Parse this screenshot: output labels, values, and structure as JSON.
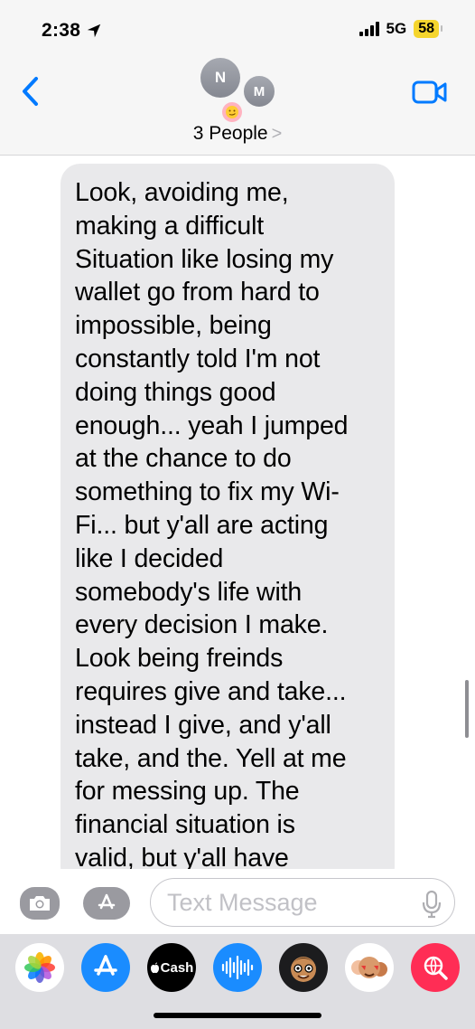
{
  "status_bar": {
    "time": "2:38",
    "network": "5G",
    "battery": "58"
  },
  "header": {
    "avatars": [
      {
        "initial": "N"
      },
      {
        "initial": "M"
      }
    ],
    "group_name": "3 People",
    "chevron": ">"
  },
  "message": {
    "text": "Look, avoiding me,\nmaking a difficult\nSituation like losing my\nwallet go from hard to\nimpossible, being\nconstantly told I'm not\ndoing things good\nenough... yeah I jumped\nat the chance to do\nsomething to fix my Wi-\nFi... but y'all are acting\nlike I decided\nsomebody's life with\nevery decision I make.\nLook being freinds\nrequires give and take...\ninstead I give, and y'all\ntake, and the. Yell at me\nfor messing up. The\nfinancial situation is\nvalid, but y'all have"
  },
  "composer": {
    "placeholder": "Text Message"
  },
  "app_drawer": {
    "apps": [
      {
        "name": "photos-app-icon"
      },
      {
        "name": "app-store-icon"
      },
      {
        "name": "apple-cash-icon",
        "label": "Cash"
      },
      {
        "name": "audio-message-icon"
      },
      {
        "name": "memoji-icon"
      },
      {
        "name": "memoji-stickers-icon"
      },
      {
        "name": "image-search-icon"
      }
    ]
  },
  "colors": {
    "accent": "#007aff",
    "bubble_gray": "#e9e9eb",
    "battery_yellow": "#f5d52d"
  }
}
